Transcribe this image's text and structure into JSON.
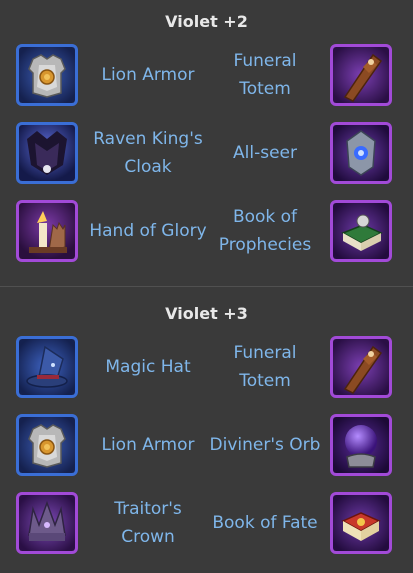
{
  "sections": [
    {
      "title": "Violet +2",
      "rows": [
        {
          "left": {
            "name": "Lion Armor",
            "icon": "lion-armor-icon"
          },
          "right": {
            "name": "Funeral Totem",
            "icon": "funeral-totem-icon"
          }
        },
        {
          "left": {
            "name": "Raven King's Cloak",
            "icon": "raven-kings-cloak-icon"
          },
          "right": {
            "name": "All-seer",
            "icon": "all-seer-icon"
          }
        },
        {
          "left": {
            "name": "Hand of Glory",
            "icon": "hand-of-glory-icon"
          },
          "right": {
            "name": "Book of Prophecies",
            "icon": "book-of-prophecies-icon"
          }
        }
      ]
    },
    {
      "title": "Violet +3",
      "rows": [
        {
          "left": {
            "name": "Magic Hat",
            "icon": "magic-hat-icon"
          },
          "right": {
            "name": "Funeral Totem",
            "icon": "funeral-totem-icon"
          }
        },
        {
          "left": {
            "name": "Lion Armor",
            "icon": "lion-armor-icon"
          },
          "right": {
            "name": "Diviner's Orb",
            "icon": "diviners-orb-icon"
          }
        },
        {
          "left": {
            "name": "Traitor's Crown",
            "icon": "traitors-crown-icon"
          },
          "right": {
            "name": "Book of Fate",
            "icon": "book-of-fate-icon"
          }
        }
      ]
    }
  ]
}
